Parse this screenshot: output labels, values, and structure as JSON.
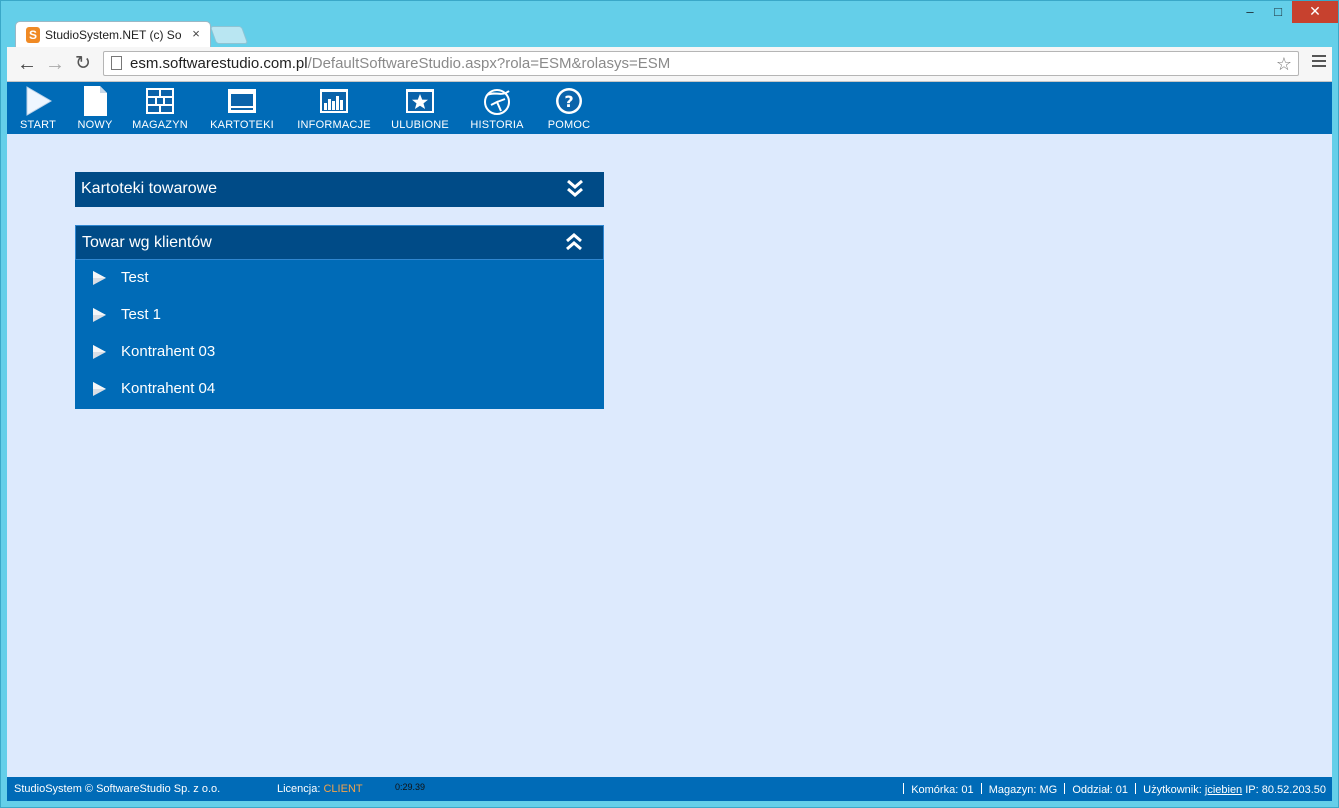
{
  "browser": {
    "tab_title": "StudioSystem.NET (c) Soft",
    "tab_close": "×",
    "url_host": "esm.softwarestudio.com.pl",
    "url_path": "/DefaultSoftwareStudio.aspx?rola=ESM&rolasys=ESM",
    "favicon_letter": "S"
  },
  "appbar": {
    "items": [
      {
        "label": "START",
        "icon": "play-icon"
      },
      {
        "label": "NOWY",
        "icon": "new-document-icon"
      },
      {
        "label": "MAGAZYN",
        "icon": "warehouse-grid-icon"
      },
      {
        "label": "KARTOTEKI",
        "icon": "card-index-icon"
      },
      {
        "label": "INFORMACJE",
        "icon": "bar-chart-icon"
      },
      {
        "label": "ULUBIONE",
        "icon": "star-icon"
      },
      {
        "label": "HISTORIA",
        "icon": "history-globe-icon"
      },
      {
        "label": "POMOC",
        "icon": "help-icon"
      }
    ]
  },
  "panels": [
    {
      "title": "Kartoteki towarowe",
      "expanded": false
    },
    {
      "title": "Towar wg klientów",
      "expanded": true,
      "items": [
        "Test",
        "Test 1",
        "Kontrahent 03",
        "Kontrahent 04"
      ]
    }
  ],
  "statusbar": {
    "copyright": "StudioSystem © SoftwareStudio Sp. z o.o.",
    "license_label": "Licencja:",
    "license_value": "CLIENT",
    "time": "0:29.39",
    "cell_label": "Komórka:",
    "cell_value": "01",
    "warehouse_label": "Magazyn:",
    "warehouse_value": "MG",
    "branch_label": "Oddział:",
    "branch_value": "01",
    "user_label": "Użytkownik:",
    "user_value": "jciebien",
    "ip_label": "IP:",
    "ip_value": "80.52.203.50"
  },
  "colors": {
    "appbar": "#006bb7",
    "panel_header": "#004b87",
    "content_bg": "#ddeafd",
    "license_accent": "#f2a24a"
  }
}
